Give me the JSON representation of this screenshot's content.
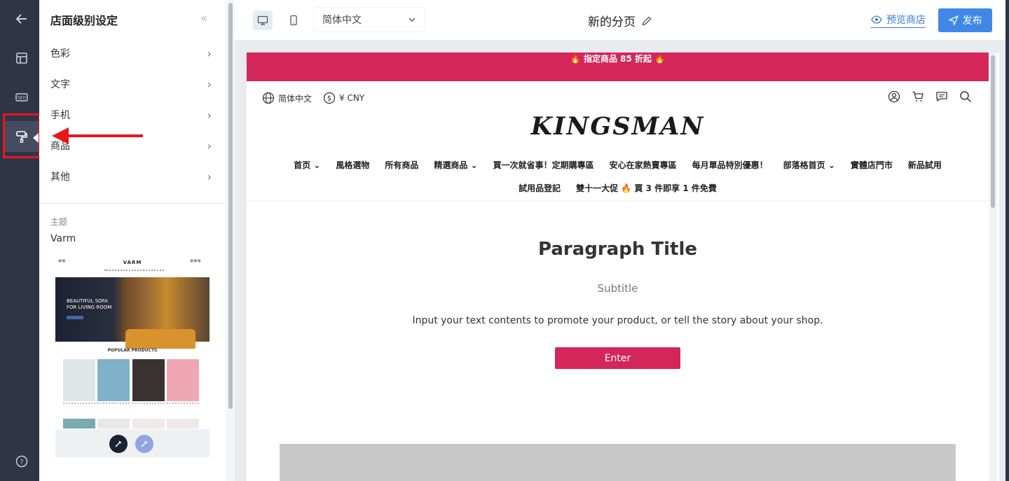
{
  "panel": {
    "title": "店面级别设定",
    "menu": [
      {
        "label": "色彩"
      },
      {
        "label": "文字"
      },
      {
        "label": "手机"
      },
      {
        "label": "商品"
      },
      {
        "label": "其他"
      }
    ],
    "theme_label": "主题",
    "theme_name": "Varm",
    "theme_preview": {
      "logo": "VARM",
      "hero_text": "BEAUTIFUL SOFA\nFOR LIVING ROOM",
      "popular": "POPULAR PRODUCTS"
    }
  },
  "topbar": {
    "language": "简体中文",
    "page_name": "新的分页",
    "preview_label": "预览商店",
    "publish_label": "发布"
  },
  "store": {
    "announcement": "🔥 指定商品 85 折起 🔥",
    "lang": "简体中文",
    "currency": "¥ CNY",
    "brand": "KINGSMAN",
    "nav_row1": [
      "首页 ⌄",
      "風格選物",
      "所有商品",
      "精選商品 ⌄",
      "買一次就省事！定期購專區",
      "安心在家熱賣專區",
      "每月單品特別優惠！",
      "部落格首页 ⌄",
      "實體店門市",
      "新品試用"
    ],
    "nav_row2": [
      "試用品登記",
      "雙十一大促 🔥 買 3 件即享 1 件免費"
    ],
    "paragraph_title": "Paragraph Title",
    "subtitle": "Subtitle",
    "body_text": "Input your text contents to promote your product, or tell the story about your shop.",
    "enter_label": "Enter"
  },
  "colors": {
    "accent": "#d4265a",
    "publish": "#3f88e6",
    "rail": "#2f3546",
    "annotation": "#e8161a"
  }
}
